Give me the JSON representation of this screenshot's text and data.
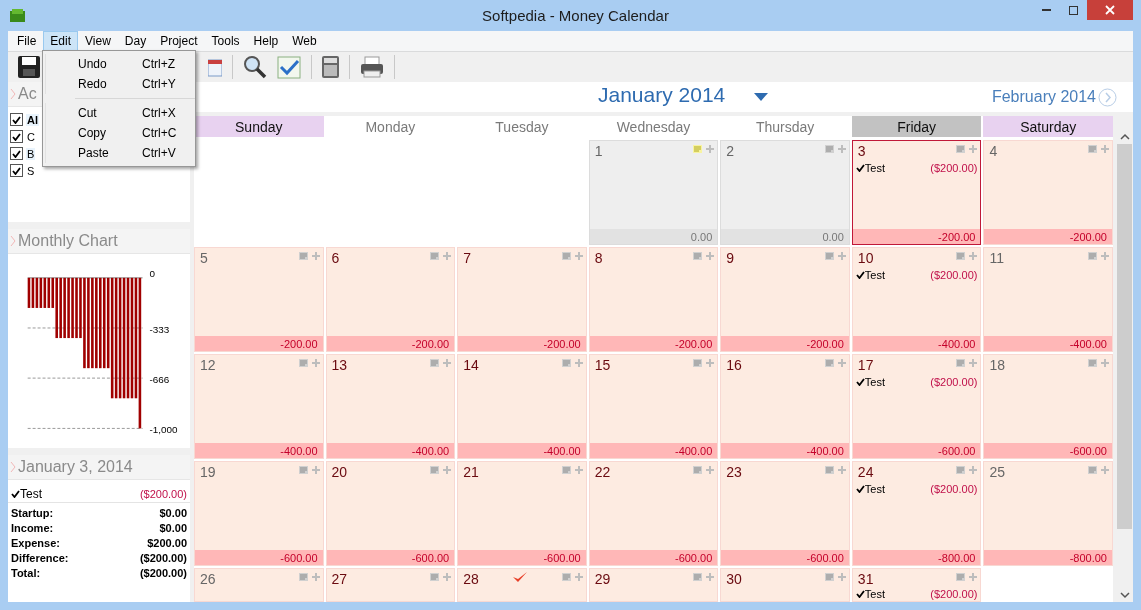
{
  "window": {
    "title": "Softpedia - Money Calendar"
  },
  "menu_bar": [
    {
      "label": "File",
      "selected": false
    },
    {
      "label": "Edit",
      "selected": true
    },
    {
      "label": "View",
      "selected": false
    },
    {
      "label": "Day",
      "selected": false
    },
    {
      "label": "Project",
      "selected": false
    },
    {
      "label": "Tools",
      "selected": false
    },
    {
      "label": "Help",
      "selected": false
    },
    {
      "label": "Web",
      "selected": false
    }
  ],
  "edit_menu": [
    [
      {
        "label": "Undo",
        "shortcut": "Ctrl+Z"
      },
      {
        "label": "Redo",
        "shortcut": "Ctrl+Y"
      }
    ],
    [
      {
        "label": "Cut",
        "shortcut": "Ctrl+X"
      },
      {
        "label": "Copy",
        "shortcut": "Ctrl+C"
      },
      {
        "label": "Paste",
        "shortcut": "Ctrl+V"
      }
    ]
  ],
  "accounts": {
    "title": "Ac",
    "items": [
      {
        "label": "Al",
        "kind": "total",
        "checked": true
      },
      {
        "label": "C",
        "kind": "account",
        "checked": true
      },
      {
        "label": "B",
        "kind": "account",
        "checked": true
      },
      {
        "label": "S",
        "kind": "account",
        "checked": true
      }
    ]
  },
  "monthly_chart": {
    "title": "Monthly Chart",
    "chart_data": {
      "type": "bar",
      "series": [
        {
          "color": "#a00000",
          "values": [
            -200,
            -200,
            -200,
            -200,
            -200,
            -200,
            -200,
            -400,
            -400,
            -400,
            -400,
            -400,
            -400,
            -400,
            -600,
            -600,
            -600,
            -600,
            -600,
            -600,
            -600,
            -800,
            -800,
            -800,
            -800,
            -800,
            -800,
            -800,
            -1000
          ]
        }
      ],
      "ylim": [
        -1000,
        0
      ],
      "yticks": [
        {
          "value": 0,
          "label": "0"
        },
        {
          "value": -333,
          "label": "-333"
        },
        {
          "value": -666,
          "label": "-666"
        },
        {
          "value": -1000,
          "label": "-1,000"
        }
      ]
    }
  },
  "day_detail": {
    "title": "January 3, 2014",
    "entries": [
      {
        "label": "Test",
        "amount": "($200.00)",
        "checked": true
      }
    ],
    "summary": [
      {
        "label": "Startup:",
        "value": "$0.00"
      },
      {
        "label": "Income:",
        "value": "$0.00"
      },
      {
        "label": "Expense:",
        "value": "$200.00"
      },
      {
        "label": "Difference:",
        "value": "($200.00)"
      },
      {
        "label": "Total:",
        "value": "($200.00)"
      }
    ]
  },
  "calendar": {
    "month": "January 2014",
    "next_month": "February 2014",
    "weekdays": [
      {
        "label": "Sunday",
        "weekend": true,
        "selected": false
      },
      {
        "label": "Monday",
        "weekend": false,
        "selected": false
      },
      {
        "label": "Tuesday",
        "weekend": false,
        "selected": false
      },
      {
        "label": "Wednesday",
        "weekend": false,
        "selected": false
      },
      {
        "label": "Thursday",
        "weekend": false,
        "selected": false
      },
      {
        "label": "Friday",
        "weekend": false,
        "selected": true
      },
      {
        "label": "Saturday",
        "weekend": true,
        "selected": false
      }
    ],
    "weeks": [
      [
        {
          "kind": "blank"
        },
        {
          "kind": "blank"
        },
        {
          "kind": "blank"
        },
        {
          "kind": "neutral",
          "day": "1",
          "selected": false,
          "note": true,
          "today": false,
          "total": "0.00"
        },
        {
          "kind": "neutral",
          "day": "2",
          "selected": false,
          "note": false,
          "today": false,
          "total": "0.00"
        },
        {
          "kind": "negative",
          "day": "3",
          "selected": true,
          "note": false,
          "today": false,
          "entries": [
            {
              "label": "Test",
              "amount": "($200.00)",
              "checked": true
            }
          ],
          "total": "-200.00"
        },
        {
          "kind": "negative",
          "day": "4",
          "selected": false,
          "note": false,
          "today": false,
          "total": "-200.00"
        }
      ],
      [
        {
          "kind": "negative",
          "day": "5",
          "selected": false,
          "note": false,
          "today": false,
          "total": "-200.00"
        },
        {
          "kind": "negative",
          "day": "6",
          "selected": false,
          "note": false,
          "today": false,
          "total": "-200.00"
        },
        {
          "kind": "negative",
          "day": "7",
          "selected": false,
          "note": false,
          "today": false,
          "total": "-200.00"
        },
        {
          "kind": "negative",
          "day": "8",
          "selected": false,
          "note": false,
          "today": false,
          "total": "-200.00"
        },
        {
          "kind": "negative",
          "day": "9",
          "selected": false,
          "note": false,
          "today": false,
          "total": "-200.00"
        },
        {
          "kind": "negative",
          "day": "10",
          "selected": false,
          "note": false,
          "today": false,
          "entries": [
            {
              "label": "Test",
              "amount": "($200.00)",
              "checked": true
            }
          ],
          "total": "-400.00"
        },
        {
          "kind": "negative",
          "day": "11",
          "selected": false,
          "note": false,
          "today": false,
          "total": "-400.00"
        }
      ],
      [
        {
          "kind": "negative",
          "day": "12",
          "selected": false,
          "note": false,
          "today": false,
          "total": "-400.00"
        },
        {
          "kind": "negative",
          "day": "13",
          "selected": false,
          "note": false,
          "today": false,
          "total": "-400.00"
        },
        {
          "kind": "negative",
          "day": "14",
          "selected": false,
          "note": false,
          "today": false,
          "total": "-400.00"
        },
        {
          "kind": "negative",
          "day": "15",
          "selected": false,
          "note": false,
          "today": false,
          "total": "-400.00"
        },
        {
          "kind": "negative",
          "day": "16",
          "selected": false,
          "note": false,
          "today": false,
          "total": "-400.00"
        },
        {
          "kind": "negative",
          "day": "17",
          "selected": false,
          "note": false,
          "today": false,
          "entries": [
            {
              "label": "Test",
              "amount": "($200.00)",
              "checked": true
            }
          ],
          "total": "-600.00"
        },
        {
          "kind": "negative",
          "day": "18",
          "selected": false,
          "note": false,
          "today": false,
          "total": "-600.00"
        }
      ],
      [
        {
          "kind": "negative",
          "day": "19",
          "selected": false,
          "note": false,
          "today": false,
          "total": "-600.00"
        },
        {
          "kind": "negative",
          "day": "20",
          "selected": false,
          "note": false,
          "today": false,
          "total": "-600.00"
        },
        {
          "kind": "negative",
          "day": "21",
          "selected": false,
          "note": false,
          "today": false,
          "total": "-600.00"
        },
        {
          "kind": "negative",
          "day": "22",
          "selected": false,
          "note": false,
          "today": false,
          "total": "-600.00"
        },
        {
          "kind": "negative",
          "day": "23",
          "selected": false,
          "note": false,
          "today": false,
          "total": "-600.00"
        },
        {
          "kind": "negative",
          "day": "24",
          "selected": false,
          "note": false,
          "today": false,
          "entries": [
            {
              "label": "Test",
              "amount": "($200.00)",
              "checked": true
            }
          ],
          "total": "-800.00"
        },
        {
          "kind": "negative",
          "day": "25",
          "selected": false,
          "note": false,
          "today": false,
          "total": "-800.00"
        }
      ],
      [
        {
          "kind": "negative",
          "day": "26",
          "selected": false,
          "note": false,
          "today": false
        },
        {
          "kind": "negative",
          "day": "27",
          "selected": false,
          "note": false,
          "today": false
        },
        {
          "kind": "negative",
          "day": "28",
          "selected": false,
          "note": false,
          "today": true
        },
        {
          "kind": "negative",
          "day": "29",
          "selected": false,
          "note": false,
          "today": false
        },
        {
          "kind": "negative",
          "day": "30",
          "selected": false,
          "note": false,
          "today": false
        },
        {
          "kind": "negative",
          "day": "31",
          "selected": false,
          "note": false,
          "today": false,
          "entries": [
            {
              "label": "Test",
              "amount": "($200.00)",
              "checked": true
            }
          ]
        },
        {
          "kind": "blank"
        }
      ]
    ]
  }
}
